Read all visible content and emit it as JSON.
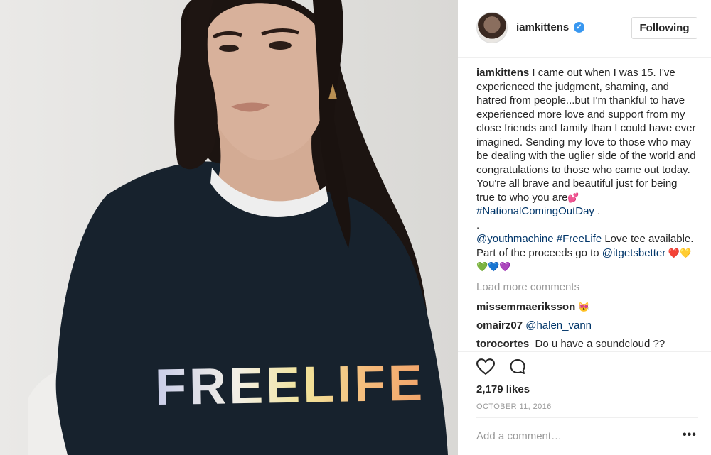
{
  "post": {
    "image_shirt_text": "FREELIFE",
    "colors": {
      "shirt": "#17222d",
      "hair": "#1a120f",
      "skin": "#d7b09a",
      "wall": "#e2e1de",
      "link": "#003569",
      "verified": "#3897f0"
    }
  },
  "header": {
    "username": "iamkittens",
    "verified_icon": "✓",
    "follow_label": "Following"
  },
  "caption": {
    "username": "iamkittens",
    "text": " I came out when I was 15. I've experienced the judgment, shaming, and hatred from people...but I'm thankful to have experienced more love and support from my close friends and family than I could have ever imagined. Sending my love to those who may be dealing with the uglier side of the world and congratulations to those who came out today. You're all brave and beautiful just for being true to who you are",
    "emoji_1": "💕",
    "hashtag": "#NationalComingOutDay",
    "end": " .",
    "dot": ".",
    "mention_1": "@youthmachine",
    "hashtag_2": "#FreeLife",
    "text_2": " Love tee available. Part of the proceeds go to ",
    "mention_2": "@itgetsbetter",
    "hearts": " ❤️💛💚💙💜"
  },
  "load_more": "Load more comments",
  "comments": [
    {
      "user": "missemmaeriksson",
      "text": "😻",
      "mention": ""
    },
    {
      "user": "omairz07",
      "text": "",
      "mention": "@halen_vann"
    },
    {
      "user": "torocortes",
      "text": "Do u have a soundcloud ??",
      "mention": ""
    }
  ],
  "likes": "2,179 likes",
  "date": "OCTOBER 11, 2016",
  "add_comment_placeholder": "Add a comment…",
  "more_icon": "•••",
  "icons": {
    "like": "heart-icon",
    "comment": "comment-bubble-icon",
    "more": "more-options-icon"
  }
}
